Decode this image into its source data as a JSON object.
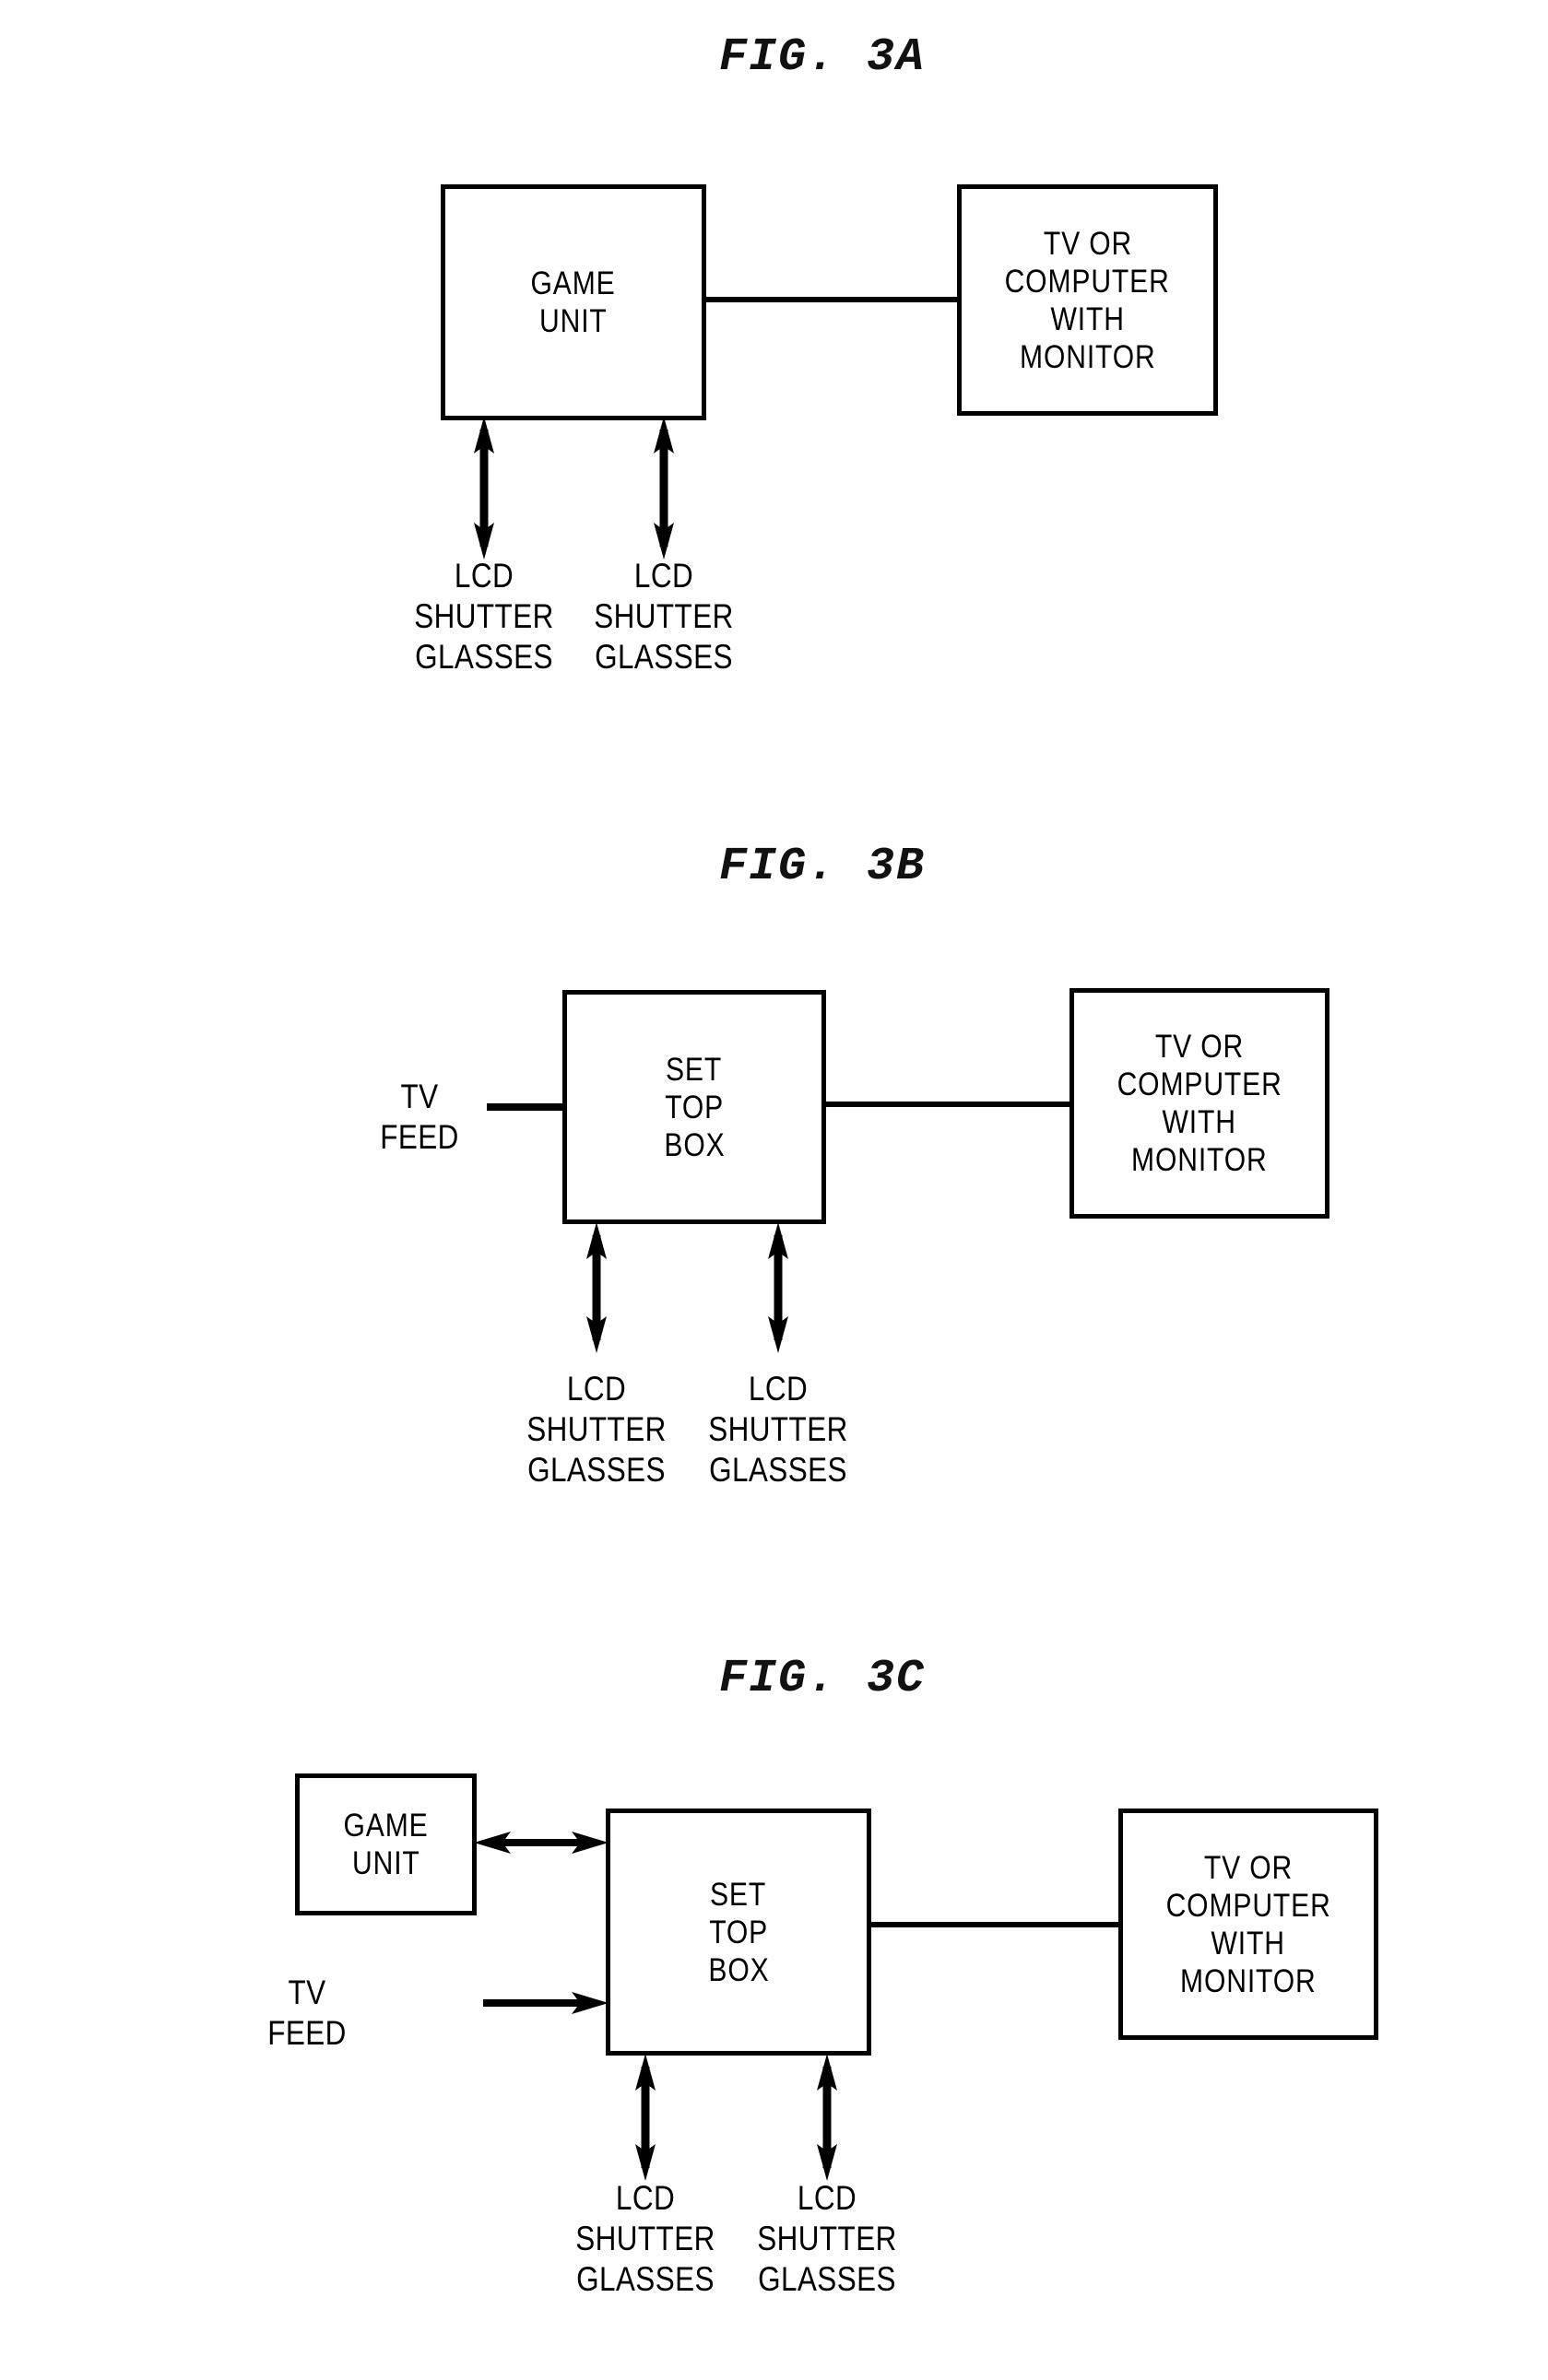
{
  "page": {
    "background": "#ffffff",
    "ink": "#000000"
  },
  "figures": [
    {
      "id": "fig-3a",
      "title": "FIG. 3A",
      "boxes": [
        {
          "name": "game-unit",
          "lines": [
            "GAME",
            "UNIT"
          ]
        },
        {
          "name": "tv-or-computer-with-monitor",
          "lines": [
            "TV OR",
            "COMPUTER",
            "WITH",
            "MONITOR"
          ]
        }
      ],
      "labels": [
        {
          "name": "lcd-shutter-glasses-left",
          "lines": [
            "LCD",
            "SHUTTER",
            "GLASSES"
          ]
        },
        {
          "name": "lcd-shutter-glasses-right",
          "lines": [
            "LCD",
            "SHUTTER",
            "GLASSES"
          ]
        }
      ],
      "connectors": [
        {
          "name": "game-unit-to-monitor-link",
          "type": "line"
        },
        {
          "name": "game-unit-to-left-glasses-arrow",
          "type": "double-arrow-vertical"
        },
        {
          "name": "game-unit-to-right-glasses-arrow",
          "type": "double-arrow-vertical"
        }
      ]
    },
    {
      "id": "fig-3b",
      "title": "FIG. 3B",
      "boxes": [
        {
          "name": "set-top-box",
          "lines": [
            "SET",
            "TOP",
            "BOX"
          ]
        },
        {
          "name": "tv-or-computer-with-monitor",
          "lines": [
            "TV OR",
            "COMPUTER",
            "WITH",
            "MONITOR"
          ]
        }
      ],
      "labels": [
        {
          "name": "tv-feed",
          "lines": [
            "TV",
            "FEED"
          ]
        },
        {
          "name": "lcd-shutter-glasses-left",
          "lines": [
            "LCD",
            "SHUTTER",
            "GLASSES"
          ]
        },
        {
          "name": "lcd-shutter-glasses-right",
          "lines": [
            "LCD",
            "SHUTTER",
            "GLASSES"
          ]
        }
      ],
      "connectors": [
        {
          "name": "tv-feed-to-set-top-box-arrow",
          "type": "single-arrow-right"
        },
        {
          "name": "set-top-box-to-monitor-link",
          "type": "line"
        },
        {
          "name": "set-top-box-to-left-glasses-arrow",
          "type": "double-arrow-vertical"
        },
        {
          "name": "set-top-box-to-right-glasses-arrow",
          "type": "double-arrow-vertical"
        }
      ]
    },
    {
      "id": "fig-3c",
      "title": "FIG. 3C",
      "boxes": [
        {
          "name": "game-unit",
          "lines": [
            "GAME",
            "UNIT"
          ]
        },
        {
          "name": "set-top-box",
          "lines": [
            "SET",
            "TOP",
            "BOX"
          ]
        },
        {
          "name": "tv-or-computer-with-monitor",
          "lines": [
            "TV OR",
            "COMPUTER",
            "WITH",
            "MONITOR"
          ]
        }
      ],
      "labels": [
        {
          "name": "tv-feed",
          "lines": [
            "TV",
            "FEED"
          ]
        },
        {
          "name": "lcd-shutter-glasses-left",
          "lines": [
            "LCD",
            "SHUTTER",
            "GLASSES"
          ]
        },
        {
          "name": "lcd-shutter-glasses-right",
          "lines": [
            "LCD",
            "SHUTTER",
            "GLASSES"
          ]
        }
      ],
      "connectors": [
        {
          "name": "game-unit-to-set-top-box-arrow",
          "type": "double-arrow-horizontal"
        },
        {
          "name": "tv-feed-to-set-top-box-arrow",
          "type": "single-arrow-right"
        },
        {
          "name": "set-top-box-to-monitor-link",
          "type": "line"
        },
        {
          "name": "set-top-box-to-left-glasses-arrow",
          "type": "double-arrow-vertical"
        },
        {
          "name": "set-top-box-to-right-glasses-arrow",
          "type": "double-arrow-vertical"
        }
      ]
    }
  ]
}
